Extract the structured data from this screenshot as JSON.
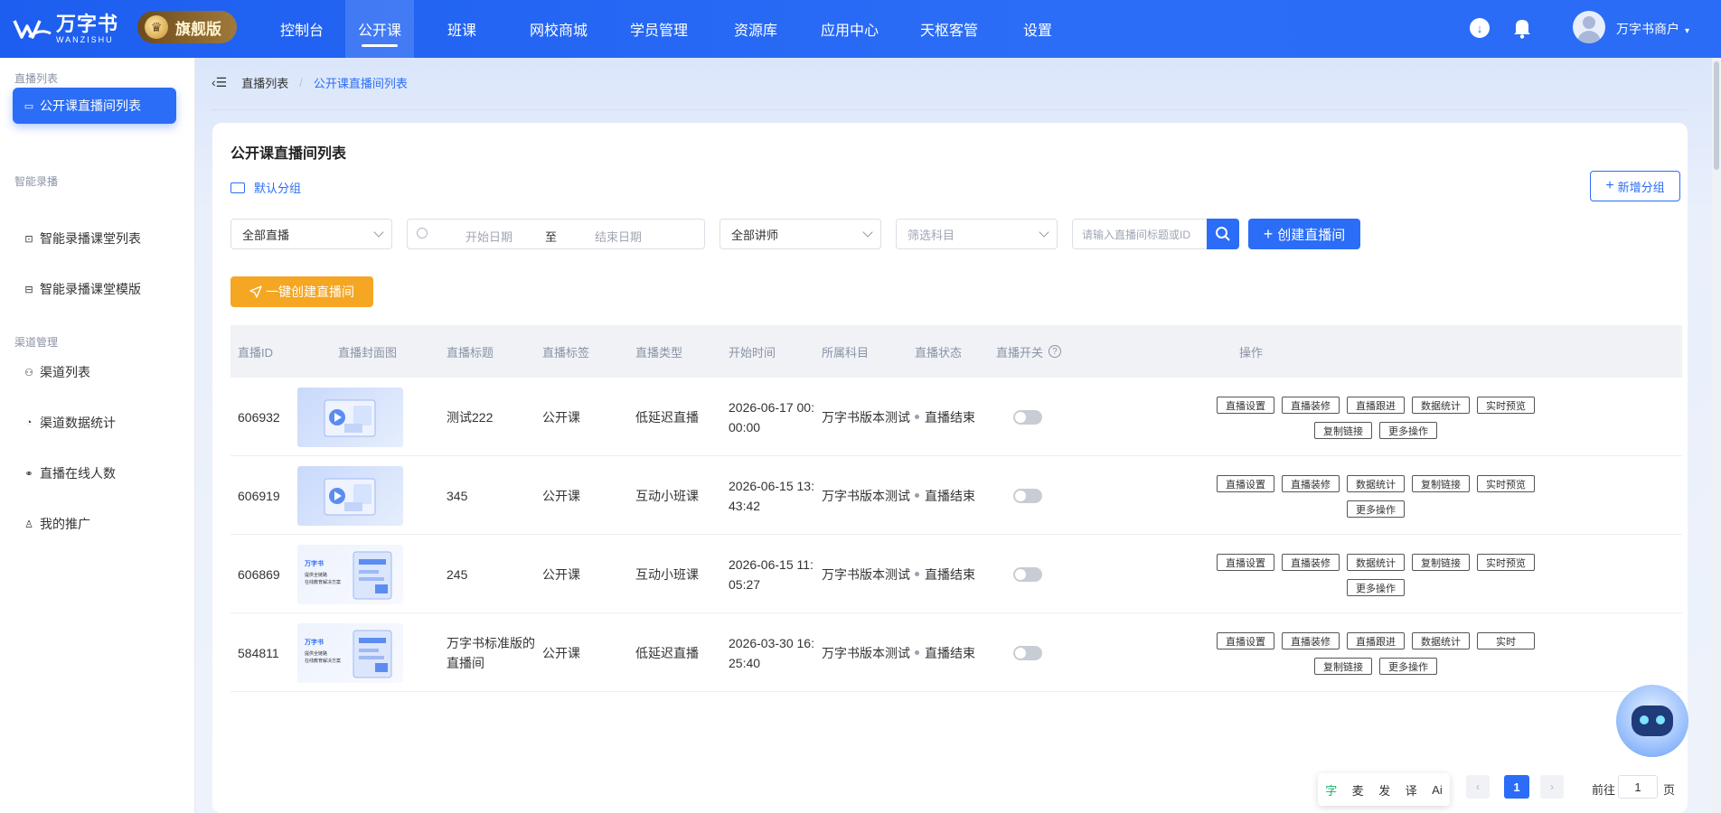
{
  "brand": {
    "name_cn": "万字书",
    "name_en": "WANZISHU",
    "edition": "旗舰版"
  },
  "nav": [
    {
      "label": "控制台",
      "active": false
    },
    {
      "label": "公开课",
      "active": true
    },
    {
      "label": "班课",
      "active": false
    },
    {
      "label": "网校商城",
      "active": false
    },
    {
      "label": "学员管理",
      "active": false
    },
    {
      "label": "资源库",
      "active": false
    },
    {
      "label": "应用中心",
      "active": false
    },
    {
      "label": "天枢客管",
      "active": false
    },
    {
      "label": "设置",
      "active": false
    }
  ],
  "user": {
    "name": "万字书商户",
    "caret": "▾"
  },
  "sidebar": {
    "sections": [
      {
        "title": "直播列表",
        "items": [
          {
            "label": "公开课直播间列表",
            "active": true
          }
        ]
      },
      {
        "title": "智能录播",
        "items": [
          {
            "label": "智能录播课堂列表"
          },
          {
            "label": "智能录播课堂模版"
          }
        ]
      },
      {
        "title": "渠道管理",
        "items": [
          {
            "label": "渠道列表"
          },
          {
            "label": "渠道数据统计"
          },
          {
            "label": "直播在线人数"
          },
          {
            "label": "我的推广"
          }
        ]
      }
    ]
  },
  "breadcrumb": {
    "parent": "直播列表",
    "sep": "/",
    "current": "公开课直播间列表"
  },
  "page": {
    "title": "公开课直播间列表",
    "group": "默认分组",
    "add_group": "新增分组",
    "filters": {
      "status": "全部直播",
      "start_placeholder": "开始日期",
      "date_sep": "至",
      "end_placeholder": "结束日期",
      "teacher": "全部讲师",
      "subject_placeholder": "筛选科目",
      "search_placeholder": "请输入直播间标题或ID"
    },
    "create_button": "创建直播间",
    "quick_create_button": "一键创建直播间"
  },
  "table": {
    "headers": {
      "id": "直播ID",
      "cover": "直播封面图",
      "title": "直播标题",
      "tag": "直播标签",
      "type": "直播类型",
      "start": "开始时间",
      "subject": "所属科目",
      "status": "直播状态",
      "switch": "直播开关",
      "help": "?",
      "ops": "操作"
    },
    "rows": [
      {
        "id": "606932",
        "cover": "blue",
        "title": [
          "测试222"
        ],
        "tag": "公开课",
        "type": "低延迟直播",
        "start": [
          "2026-06-17 00:",
          "00:00"
        ],
        "subject": "万字书版本测试",
        "status": "直播结束",
        "ops": [
          [
            "直播设置",
            "直播装修",
            "直播跟进",
            "数据统计",
            "实时预览"
          ],
          [
            "复制链接",
            "更多操作"
          ]
        ]
      },
      {
        "id": "606919",
        "cover": "blue",
        "title": [
          "345"
        ],
        "tag": "公开课",
        "type": "互动小班课",
        "start": [
          "2026-06-15 13:",
          "43:42"
        ],
        "subject": "万字书版本测试",
        "status": "直播结束",
        "ops": [
          [
            "直播设置",
            "直播装修",
            "数据统计",
            "复制链接",
            "实时预览"
          ],
          [
            "更多操作"
          ]
        ]
      },
      {
        "id": "606869",
        "cover": "white",
        "title": [
          "245"
        ],
        "tag": "公开课",
        "type": "互动小班课",
        "start": [
          "2026-06-15 11:",
          "05:27"
        ],
        "subject": "万字书版本测试",
        "status": "直播结束",
        "ops": [
          [
            "直播设置",
            "直播装修",
            "数据统计",
            "复制链接",
            "实时预览"
          ],
          [
            "更多操作"
          ]
        ]
      },
      {
        "id": "584811",
        "cover": "white",
        "title": [
          "万字书标准版的",
          "直播间"
        ],
        "tag": "公开课",
        "type": "低延迟直播",
        "start": [
          "2026-03-30 16:",
          "25:40"
        ],
        "subject": "万字书版本测试",
        "status": "直播结束",
        "ops": [
          [
            "直播设置",
            "直播装修",
            "直播跟进",
            "数据统计",
            "实时"
          ],
          [
            "复制链接",
            "更多操作"
          ]
        ]
      }
    ]
  },
  "cover_text": {
    "brand": "万字书",
    "line1": "提供全链路",
    "line2": "在线教育解决方案"
  },
  "pager": {
    "tools": [
      "字",
      "麦",
      "发",
      "译",
      "Ai"
    ],
    "prev": "‹",
    "next": "›",
    "current": "1",
    "goto": "前往",
    "goto_value": "1",
    "unit": "页"
  },
  "colors": {
    "primary": "#2b6df6",
    "orange": "#f5a623"
  }
}
